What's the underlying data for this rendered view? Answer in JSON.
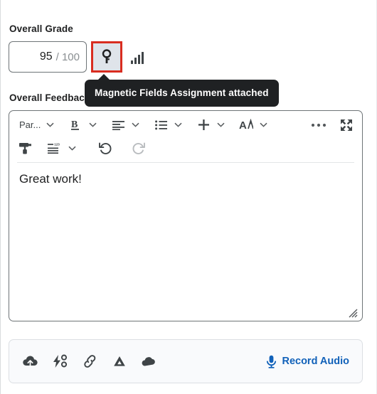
{
  "grade": {
    "label": "Overall Grade",
    "value": "95",
    "total": "/ 100",
    "key_button_icon": "key-icon",
    "stats_icon": "bar-chart-icon",
    "highlight_color": "#d92d20",
    "button_fill": "#dfe4ea"
  },
  "tooltip": {
    "text": "Magnetic Fields Assignment attached",
    "background": "#1f2123",
    "text_color": "#ffffff"
  },
  "feedback": {
    "label": "Overall Feedback",
    "content": "Great work!"
  },
  "toolbar": {
    "row1": [
      {
        "name": "paragraph-format-dropdown",
        "label": "Par...",
        "icon": "text-format-icon",
        "chevron": true
      },
      {
        "name": "bold-button",
        "label": "",
        "icon": "bold-icon",
        "chevron": true
      },
      {
        "name": "align-button",
        "label": "",
        "icon": "align-left-icon",
        "chevron": true
      },
      {
        "name": "list-button",
        "label": "",
        "icon": "bulleted-list-icon",
        "chevron": true
      },
      {
        "name": "insert-button",
        "label": "",
        "icon": "plus-icon",
        "chevron": true
      },
      {
        "name": "font-style-button",
        "label": "",
        "icon": "font-accessibility-icon",
        "chevron": true
      },
      {
        "name": "more-options-button",
        "label": "",
        "icon": "ellipsis-icon",
        "chevron": false
      },
      {
        "name": "fullscreen-button",
        "label": "",
        "icon": "expand-arrows-icon",
        "chevron": false
      }
    ],
    "row2": [
      {
        "name": "format-painter-button",
        "label": "",
        "icon": "format-painter-icon",
        "chevron": false
      },
      {
        "name": "line-spacing-button",
        "label": "",
        "icon": "line-spacing-123-icon",
        "chevron": true
      },
      {
        "name": "undo-button",
        "label": "",
        "icon": "undo-icon",
        "chevron": false
      },
      {
        "name": "redo-button",
        "label": "",
        "icon": "redo-icon",
        "chevron": false,
        "disabled": true
      }
    ]
  },
  "attach_bar": {
    "icons": [
      {
        "name": "upload-cloud-icon"
      },
      {
        "name": "quicklink-icon"
      },
      {
        "name": "insert-link-icon"
      },
      {
        "name": "google-drive-icon"
      },
      {
        "name": "onedrive-icon"
      }
    ],
    "record_label": "Record Audio",
    "record_icon": "microphone-icon",
    "record_color": "#1161b9",
    "background": "#f9fafc"
  }
}
